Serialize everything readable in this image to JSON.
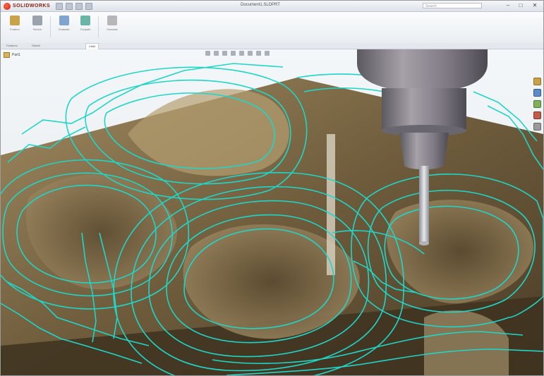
{
  "app": {
    "logo_text": "SOLIDWORKS",
    "document_title": "Document1.SLDPRT",
    "search_placeholder": "Search"
  },
  "window_controls": [
    "–",
    "□",
    "✕"
  ],
  "ribbon": {
    "buttons": [
      {
        "label": "Feature",
        "icon": "extrude-icon",
        "color": "#c9a24a"
      },
      {
        "label": "Sketch",
        "icon": "sketch-icon",
        "color": "#9aa2ad"
      },
      {
        "label": "Evaluate",
        "icon": "evaluate-icon",
        "color": "#7fa4cf"
      },
      {
        "label": "Toolpath",
        "icon": "toolpath-icon",
        "color": "#6bb5a8"
      },
      {
        "label": "Simulate",
        "icon": "simulate-icon",
        "color": "#b7b7b7"
      }
    ]
  },
  "tabs": [
    {
      "label": "Features",
      "active": false
    },
    {
      "label": "Sketch",
      "active": false
    },
    {
      "label": "CAM",
      "active": true
    }
  ],
  "feature_tree": {
    "root_label": "Part1"
  },
  "colors": {
    "toolpath": "#1fd6c8",
    "part": "#7e6a48",
    "spindle": "#7a767e",
    "tool": "#c9ccd2"
  }
}
